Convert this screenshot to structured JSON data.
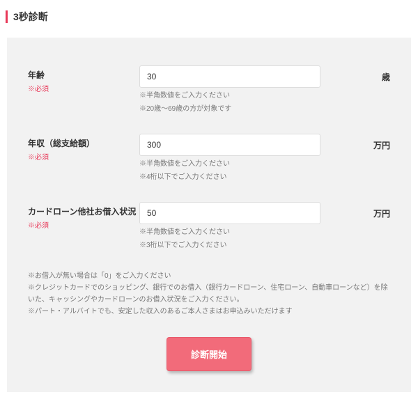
{
  "header": {
    "title": "3秒診断"
  },
  "form": {
    "required_label": "※必須",
    "fields": {
      "age": {
        "label": "年齢",
        "value": "30",
        "unit": "歳",
        "hint1": "※半角数値をご入力ください",
        "hint2": "※20歳〜69歳の方が対象です"
      },
      "income": {
        "label": "年収（総支給額）",
        "value": "300",
        "unit": "万円",
        "hint1": "※半角数値をご入力ください",
        "hint2": "※4桁以下でご入力ください"
      },
      "debt": {
        "label": "カードローン他社お借入状況",
        "value": "50",
        "unit": "万円",
        "hint1": "※半角数値をご入力ください",
        "hint2": "※3桁以下でご入力ください"
      }
    },
    "notes": [
      "※お借入が無い場合は「0」をご入力ください",
      "※クレジットカードでのショッピング、銀行でのお借入（銀行カードローン、住宅ローン、自動車ローンなど）を除いた、キャッシングやカードローンのお借入状況をご入力ください。",
      "※パート・アルバイトでも、安定した収入のあるご本人さまはお申込みいただけます"
    ],
    "submit_label": "診断開始"
  }
}
